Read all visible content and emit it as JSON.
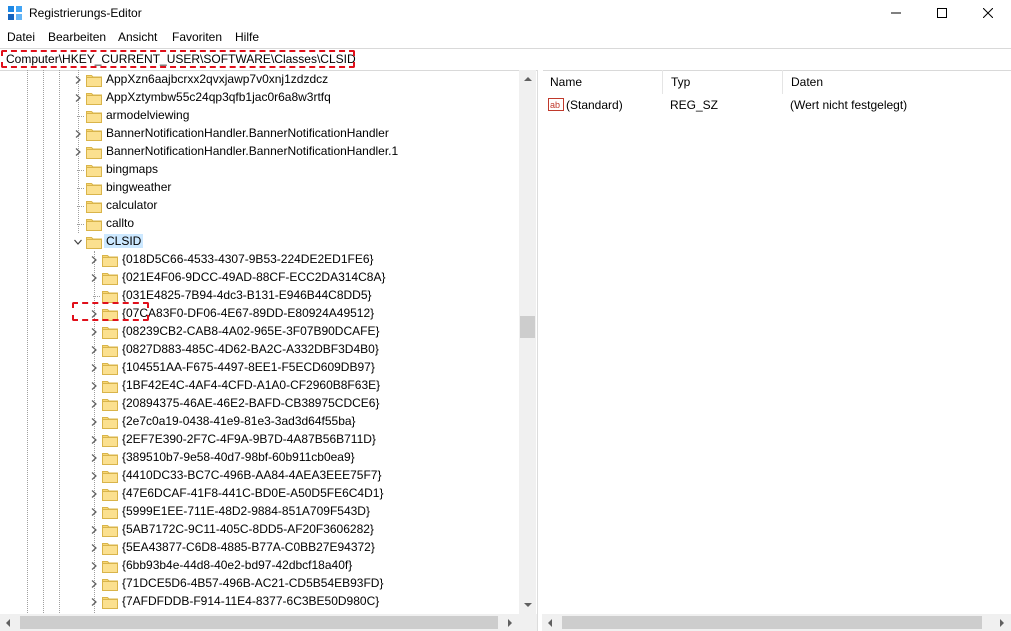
{
  "window": {
    "title": "Registrierungs-Editor"
  },
  "menu": [
    "Datei",
    "Bearbeiten",
    "Ansicht",
    "Favoriten",
    "Hilfe"
  ],
  "address": "Computer\\HKEY_CURRENT_USER\\SOFTWARE\\Classes\\CLSID",
  "tree": {
    "level1": [
      {
        "label": "AppXzn6aajbcrxx2qvxjawp7v0xnj1zdzdcz",
        "expandable": true
      },
      {
        "label": "AppXztymbw55c24qp3qfb1jac0r6a8w3rtfq",
        "expandable": true
      },
      {
        "label": "armodelviewing",
        "expandable": false
      },
      {
        "label": "BannerNotificationHandler.BannerNotificationHandler",
        "expandable": true
      },
      {
        "label": "BannerNotificationHandler.BannerNotificationHandler.1",
        "expandable": true
      },
      {
        "label": "bingmaps",
        "expandable": false
      },
      {
        "label": "bingweather",
        "expandable": false
      },
      {
        "label": "calculator",
        "expandable": false
      },
      {
        "label": "callto",
        "expandable": false
      },
      {
        "label": "CLSID",
        "expandable": true,
        "expanded": true,
        "selected": true
      }
    ],
    "clsid_children": [
      {
        "label": "{018D5C66-4533-4307-9B53-224DE2ED1FE6}",
        "expandable": true
      },
      {
        "label": "{021E4F06-9DCC-49AD-88CF-ECC2DA314C8A}",
        "expandable": true
      },
      {
        "label": "{031E4825-7B94-4dc3-B131-E946B44C8DD5}",
        "expandable": false
      },
      {
        "label": "{07CA83F0-DF06-4E67-89DD-E80924A49512}",
        "expandable": true
      },
      {
        "label": "{08239CB2-CAB8-4A02-965E-3F07B90DCAFE}",
        "expandable": true
      },
      {
        "label": "{0827D883-485C-4D62-BA2C-A332DBF3D4B0}",
        "expandable": true
      },
      {
        "label": "{104551AA-F675-4497-8EE1-F5ECD609DB97}",
        "expandable": true
      },
      {
        "label": "{1BF42E4C-4AF4-4CFD-A1A0-CF2960B8F63E}",
        "expandable": true
      },
      {
        "label": "{20894375-46AE-46E2-BAFD-CB38975CDCE6}",
        "expandable": true
      },
      {
        "label": "{2e7c0a19-0438-41e9-81e3-3ad3d64f55ba}",
        "expandable": true
      },
      {
        "label": "{2EF7E390-2F7C-4F9A-9B7D-4A87B56B711D}",
        "expandable": true
      },
      {
        "label": "{389510b7-9e58-40d7-98bf-60b911cb0ea9}",
        "expandable": true
      },
      {
        "label": "{4410DC33-BC7C-496B-AA84-4AEA3EEE75F7}",
        "expandable": true
      },
      {
        "label": "{47E6DCAF-41F8-441C-BD0E-A50D5FE6C4D1}",
        "expandable": true
      },
      {
        "label": "{5999E1EE-711E-48D2-9884-851A709F543D}",
        "expandable": true
      },
      {
        "label": "{5AB7172C-9C11-405C-8DD5-AF20F3606282}",
        "expandable": true
      },
      {
        "label": "{5EA43877-C6D8-4885-B77A-C0BB27E94372}",
        "expandable": true
      },
      {
        "label": "{6bb93b4e-44d8-40e2-bd97-42dbcf18a40f}",
        "expandable": true
      },
      {
        "label": "{71DCE5D6-4B57-496B-AC21-CD5B54EB93FD}",
        "expandable": true
      },
      {
        "label": "{7AFDFDDB-F914-11E4-8377-6C3BE50D980C}",
        "expandable": true
      }
    ]
  },
  "values": {
    "headers": [
      "Name",
      "Typ",
      "Daten"
    ],
    "rows": [
      {
        "name": "(Standard)",
        "type": "REG_SZ",
        "data": "(Wert nicht festgelegt)"
      }
    ]
  },
  "colors": {
    "highlight": "#e0101b",
    "selection": "#cce8ff",
    "folder": "#f8d775"
  },
  "icons": [
    "registry-app-icon",
    "minimize-icon",
    "maximize-icon",
    "close-icon",
    "folder-icon",
    "chevron-right-icon",
    "chevron-down-icon",
    "string-value-icon"
  ]
}
